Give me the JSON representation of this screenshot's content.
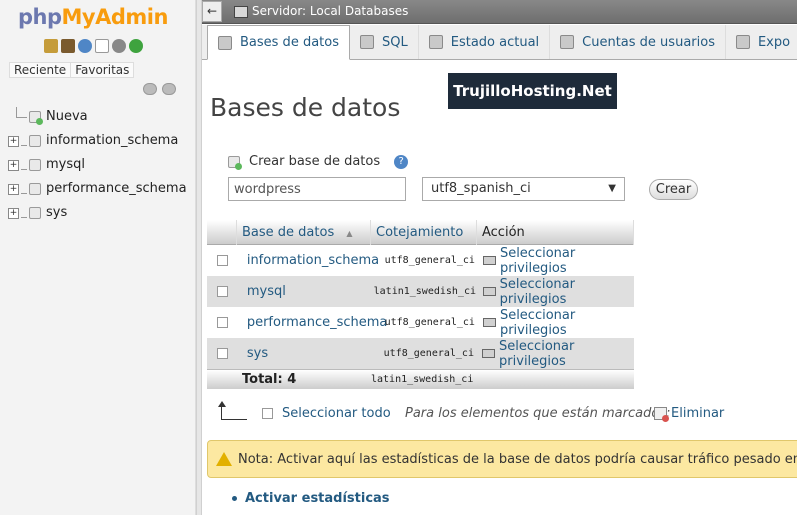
{
  "app": {
    "logo_php": "php",
    "logo_myadmin": "MyAdmin"
  },
  "nav": {
    "tabs": [
      "Reciente",
      "Favoritas"
    ],
    "tree": [
      {
        "label": "Nueva",
        "type": "new"
      },
      {
        "label": "information_schema",
        "type": "db"
      },
      {
        "label": "mysql",
        "type": "db"
      },
      {
        "label": "performance_schema",
        "type": "db"
      },
      {
        "label": "sys",
        "type": "db"
      }
    ]
  },
  "topbar": {
    "server": "Servidor: Local Databases",
    "collapse_glyph": "←"
  },
  "tabs": [
    {
      "label": "Bases de datos",
      "active": true,
      "icon": "database-icon"
    },
    {
      "label": "SQL",
      "active": false,
      "icon": "sql-icon"
    },
    {
      "label": "Estado actual",
      "active": false,
      "icon": "status-icon"
    },
    {
      "label": "Cuentas de usuarios",
      "active": false,
      "icon": "users-icon"
    },
    {
      "label": "Expo",
      "active": false,
      "icon": "export-icon"
    }
  ],
  "watermark": "TrujilloHosting.Net",
  "page_title": "Bases de datos",
  "create": {
    "label": "Crear base de datos",
    "help_glyph": "?",
    "name_value": "wordpress",
    "collation_value": "utf8_spanish_ci",
    "select_arrow": "▼",
    "button_label": "Crear"
  },
  "table": {
    "headers": {
      "name": "Base de datos",
      "sort_glyph": "▲",
      "collation": "Cotejamiento",
      "action": "Acción"
    },
    "rows": [
      {
        "name": "information_schema",
        "collation": "utf8_general_ci",
        "action": "Seleccionar privilegios"
      },
      {
        "name": "mysql",
        "collation": "latin1_swedish_ci",
        "action": "Seleccionar privilegios"
      },
      {
        "name": "performance_schema",
        "collation": "utf8_general_ci",
        "action": "Seleccionar privilegios"
      },
      {
        "name": "sys",
        "collation": "utf8_general_ci",
        "action": "Seleccionar privilegios"
      }
    ],
    "footer": {
      "total": "Total: 4",
      "collation": "latin1_swedish_ci"
    }
  },
  "bulk": {
    "select_all": "Seleccionar todo",
    "marked_label": "Para los elementos que están marcados:",
    "delete_label": "Eliminar"
  },
  "notice": "Nota: Activar aquí las estadísticas de la base de datos podría causar tráfico pesado entre el ser",
  "activate_stats": "Activar estadísticas"
}
